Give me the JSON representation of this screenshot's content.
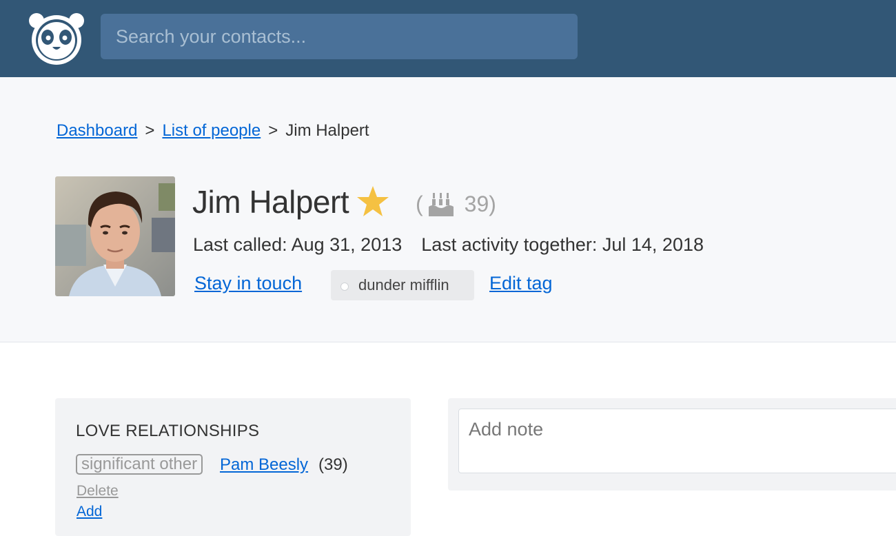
{
  "header": {
    "search_placeholder": "Search your contacts...",
    "logo_icon": "panda-logo-icon"
  },
  "breadcrumb": {
    "items": [
      "Dashboard",
      "List of people",
      "Jim Halpert"
    ],
    "separator": ">"
  },
  "profile": {
    "name": "Jim Halpert",
    "favorite_icon": "star-icon",
    "age_prefix": "(",
    "age": "39)",
    "age_icon": "birthday-cake-icon",
    "last_called": "Last called: Aug 31, 2013",
    "last_activity": "Last activity together: Jul 14, 2018",
    "stay_in_touch": "Stay in touch",
    "tag": "dunder mifflin",
    "edit_tag": "Edit tag"
  },
  "relationships": {
    "title": "LOVE RELATIONSHIPS",
    "items": [
      {
        "type": "significant other",
        "name": "Pam Beesly",
        "age": "(39)"
      }
    ],
    "delete": "Delete",
    "add": "Add"
  },
  "note": {
    "placeholder": "Add note"
  },
  "colors": {
    "header_bg": "#325776",
    "search_bg": "#4a7199",
    "link": "#0366d6",
    "star": "#f5c142"
  }
}
